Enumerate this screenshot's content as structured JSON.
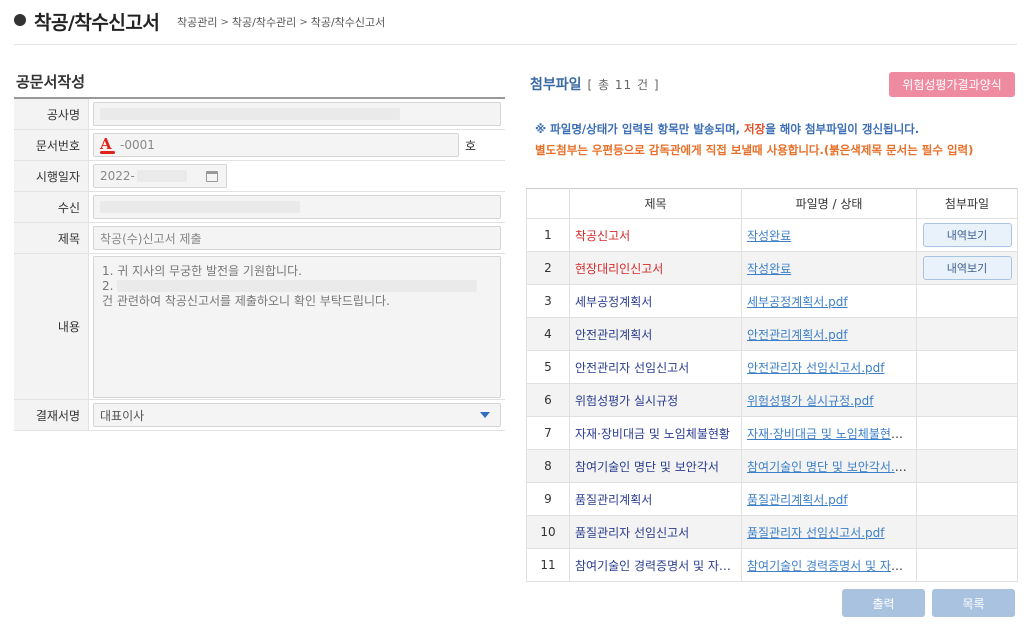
{
  "header": {
    "title": "착공/착수신고서",
    "breadcrumb": [
      "착공관리",
      "착공/착수관리",
      "착공/착수신고서"
    ]
  },
  "form": {
    "section_title": "공문서작성",
    "labels": {
      "project_name": "공사명",
      "doc_number": "문서번호",
      "date": "시행일자",
      "recipient": "수신",
      "subject": "제목",
      "content": "내용",
      "approver": "결재서명"
    },
    "doc_number_value": "-0001",
    "doc_number_suffix": "호",
    "date_value": "2022-",
    "subject_value": "착공(수)신고서 제출",
    "content_line1": "1. 귀 지사의 무궁한 발전을 기원합니다.",
    "content_line2": "2.",
    "content_line3": "건 관련하여 착공신고서를 제출하오니 확인 부탁드립니다.",
    "approver_value": "대표이사"
  },
  "attachments": {
    "title": "첨부파일",
    "count_text": "[ 총 11 건 ]",
    "risk_button": "위험성평가결과양식",
    "notice1_a": "※ 파일명/상태가 입력된 항목만 발송되며, ",
    "notice1_b": "저장",
    "notice1_c": "을 해야 첨부파일이 갱신됩니다.",
    "notice2": "별도첨부는 우편등으로 감독관에게 직접 보낼때 사용합니다.(붉은색제목 문서는 필수 입력)",
    "columns": [
      "",
      "제목",
      "파일명 / 상태",
      "첨부파일"
    ],
    "rows": [
      {
        "no": "1",
        "title": "착공신고서",
        "file": "작성완료",
        "action": "내역보기"
      },
      {
        "no": "2",
        "title": "현장대리인신고서",
        "file": "작성완료",
        "action": "내역보기"
      },
      {
        "no": "3",
        "title": "세부공정계획서",
        "file": "세부공정계획서.pdf",
        "action": ""
      },
      {
        "no": "4",
        "title": "안전관리계획서",
        "file": "안전관리계획서.pdf",
        "action": ""
      },
      {
        "no": "5",
        "title": "안전관리자 선임신고서",
        "file": "안전관리자 선임신고서.pdf",
        "action": ""
      },
      {
        "no": "6",
        "title": "위험성평가 실시규정",
        "file": "위험성평가 실시규정.pdf",
        "action": ""
      },
      {
        "no": "7",
        "title": "자재·장비대금 및 노임체불현황",
        "file": "자재·장비대금 및 노임체불현황…",
        "action": ""
      },
      {
        "no": "8",
        "title": "참여기술인 명단 및 보안각서",
        "file": "참여기술인 명단 및 보안각서.pdf",
        "action": ""
      },
      {
        "no": "9",
        "title": "품질관리계획서",
        "file": "품질관리계획서.pdf",
        "action": ""
      },
      {
        "no": "10",
        "title": "품질관리자 선임신고서",
        "file": "품질관리자 선임신고서.pdf",
        "action": ""
      },
      {
        "no": "11",
        "title": "참여기술인 경력증명서 및 자…",
        "file": "참여기술인 경력증명서 및 자격…",
        "action": ""
      }
    ]
  },
  "buttons": {
    "print": "출력",
    "list": "목록"
  }
}
